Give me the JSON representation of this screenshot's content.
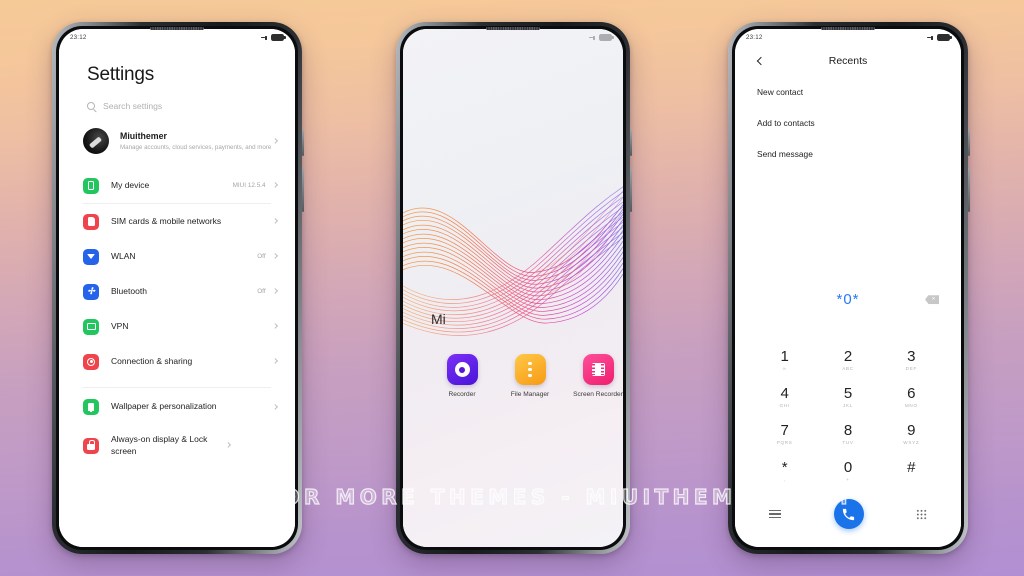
{
  "background": {
    "gradient_top": "#f6ca97",
    "gradient_bottom": "#b18fd2"
  },
  "watermark": {
    "text": "VISIT FOR MORE THEMES - MIUITHEMER.COM"
  },
  "phone_settings": {
    "statusbar": {
      "time": "23:12"
    },
    "title": "Settings",
    "search": {
      "placeholder": "Search settings"
    },
    "account": {
      "name": "Miuithemer",
      "subtitle": "Manage accounts, cloud services, payments, and more"
    },
    "items": [
      {
        "label": "My device",
        "value": "MIUI 12.5.4",
        "color": "#23c55e",
        "icon": "phone-icon"
      },
      {
        "label": "SIM cards & mobile networks",
        "value": "",
        "color": "#f0444c",
        "icon": "sim-card-icon"
      },
      {
        "label": "WLAN",
        "value": "Off",
        "color": "#2563eb",
        "icon": "wifi-icon"
      },
      {
        "label": "Bluetooth",
        "value": "Off",
        "color": "#2563eb",
        "icon": "bluetooth-icon"
      },
      {
        "label": "VPN",
        "value": "",
        "color": "#23c55e",
        "icon": "vpn-icon"
      },
      {
        "label": "Connection & sharing",
        "value": "",
        "color": "#f0444c",
        "icon": "share-icon"
      },
      {
        "label": "Wallpaper & personalization",
        "value": "",
        "color": "#23c55e",
        "icon": "wallpaper-icon"
      },
      {
        "label": "Always-on display & Lock screen",
        "value": "",
        "color": "#f0444c",
        "icon": "lock-icon"
      }
    ]
  },
  "phone_home": {
    "folder_label": "Mi",
    "apps": [
      {
        "name": "Recorder",
        "color_a": "#7b2ff7",
        "color_b": "#4a14d8"
      },
      {
        "name": "File Manager",
        "color_a": "#ffc845",
        "color_b": "#f79a16"
      },
      {
        "name": "Screen Recorder",
        "color_a": "#ff4f9a",
        "color_b": "#ee1e6e"
      }
    ]
  },
  "phone_dialer": {
    "statusbar": {
      "time": "23:12"
    },
    "header": {
      "title": "Recents",
      "back": "back-arrow-icon"
    },
    "menu": [
      "New contact",
      "Add to contacts",
      "Send message"
    ],
    "number_field": {
      "value": "*0*",
      "color": "#2979f2",
      "backspace": "backspace-icon"
    },
    "keys": [
      {
        "digit": "1",
        "sub": "∞"
      },
      {
        "digit": "2",
        "sub": "ABC"
      },
      {
        "digit": "3",
        "sub": "DEF"
      },
      {
        "digit": "4",
        "sub": "GHI"
      },
      {
        "digit": "5",
        "sub": "JKL"
      },
      {
        "digit": "6",
        "sub": "MNO"
      },
      {
        "digit": "7",
        "sub": "PQRS"
      },
      {
        "digit": "8",
        "sub": "TUV"
      },
      {
        "digit": "9",
        "sub": "WXYZ"
      },
      {
        "digit": "*",
        "sub": ","
      },
      {
        "digit": "0",
        "sub": "+"
      },
      {
        "digit": "#",
        "sub": ""
      }
    ],
    "dock": {
      "menu": "menu-icon",
      "call": "call-icon",
      "keypad": "keypad-icon"
    }
  }
}
